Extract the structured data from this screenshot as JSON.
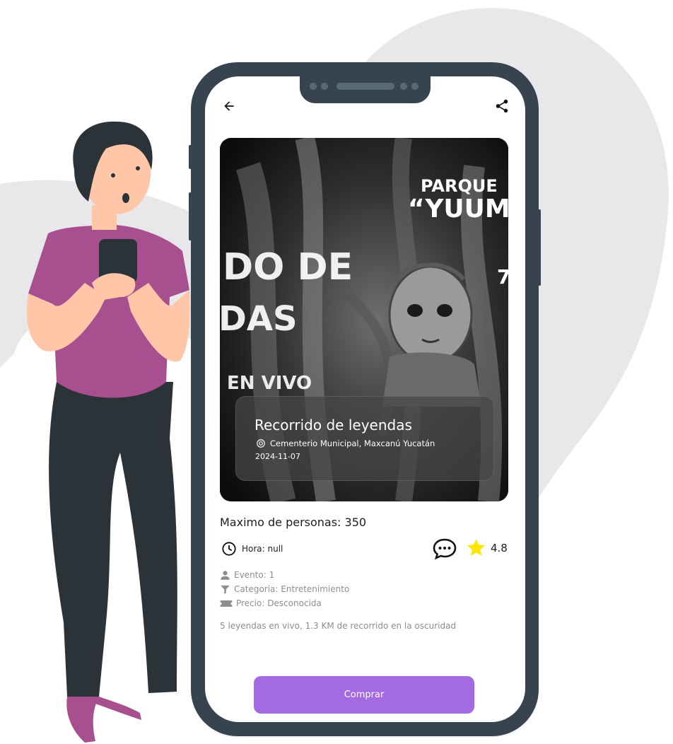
{
  "header": {
    "back_label": "back",
    "share_label": "share"
  },
  "event": {
    "poster_text": {
      "line_top": "PARQUE",
      "line_brand": "“YUUM",
      "title_fragment_1": "DO DE",
      "title_fragment_2": "DAS",
      "subtitle_fragment": "EN VIVO",
      "side_digit": "7"
    },
    "title": "Recorrido de leyendas",
    "location": "Cementerio Municipal, Maxcanú Yucatán",
    "date": "2024-11-07",
    "max_people_label": "Maximo de personas: 350",
    "hour_label": "Hora: null",
    "rating": "4.8",
    "event_label": "Evento: 1",
    "category_label": "Categoria: Entretenimiento",
    "price_label": "Precio: Desconocida",
    "description": "5 leyendas en vivo, 1.3 KM de recorrido en la oscuridad"
  },
  "actions": {
    "buy_label": "Comprar"
  },
  "colors": {
    "accent": "#a46ae4",
    "phone_frame": "#37444f",
    "background_blob": "#e8e8ea",
    "star": "#ffe600"
  },
  "icons": [
    "back-arrow-icon",
    "share-icon",
    "clock-icon",
    "chat-icon",
    "star-icon",
    "person-icon",
    "filter-icon",
    "ticket-icon",
    "location-icon"
  ]
}
